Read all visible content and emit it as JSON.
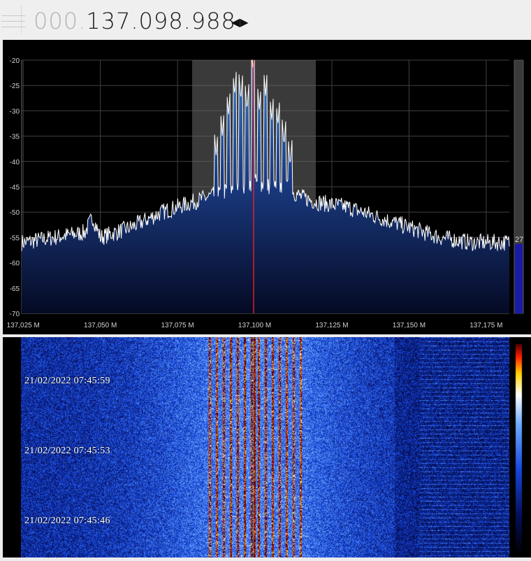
{
  "frequency": {
    "dim_part": "000.",
    "main_part": "137.098.988",
    "step_icon": "left-right-arrows"
  },
  "spectrum": {
    "y_ticks": [
      "-20",
      "-25",
      "-30",
      "-35",
      "-40",
      "-45",
      "-50",
      "-55",
      "-60",
      "-65",
      "-70"
    ],
    "x_ticks": [
      "137,025 M",
      "137,050 M",
      "137,075 M",
      "137,100 M",
      "137,125 M",
      "137,150 M",
      "137,175 M"
    ],
    "signal_meter_value": "27",
    "colors": {
      "background": "#000000",
      "grid": "#404040",
      "trace": "#ffffff",
      "fill_top": "#3f7fc6",
      "fill_bottom": "#050a24",
      "bandwidth_overlay": "#6a6a6a",
      "tuned_marker": "#ff2020"
    }
  },
  "chart_data": {
    "type": "area",
    "title": "",
    "xlabel": "",
    "ylabel": "",
    "xlim": [
      137.0245,
      137.1825
    ],
    "ylim": [
      -70,
      -20
    ],
    "x_unit": "MHz",
    "tuned_frequency": 137.098988,
    "filter_band": [
      137.0795,
      137.1185
    ],
    "series": [
      {
        "values_by_mhz": [
          [
            137.025,
            -56
          ],
          [
            137.035,
            -55
          ],
          [
            137.045,
            -54
          ],
          [
            137.0475,
            -51
          ],
          [
            137.05,
            -55
          ],
          [
            137.06,
            -53
          ],
          [
            137.07,
            -50
          ],
          [
            137.08,
            -48
          ],
          [
            137.085,
            -47
          ],
          [
            137.09,
            -46
          ],
          [
            137.095,
            -45
          ],
          [
            137.1,
            -44
          ],
          [
            137.105,
            -45
          ],
          [
            137.11,
            -45
          ],
          [
            137.115,
            -47
          ],
          [
            137.12,
            -48
          ],
          [
            137.13,
            -49
          ],
          [
            137.14,
            -51
          ],
          [
            137.15,
            -53
          ],
          [
            137.16,
            -55
          ],
          [
            137.17,
            -56
          ],
          [
            137.1825,
            -56
          ]
        ],
        "peaks_by_mhz": [
          [
            137.0875,
            -39
          ],
          [
            137.0895,
            -35
          ],
          [
            137.0915,
            -31
          ],
          [
            137.0935,
            -27
          ],
          [
            137.0955,
            -28
          ],
          [
            137.0975,
            -30
          ],
          [
            137.0995,
            -22
          ],
          [
            137.1015,
            -30
          ],
          [
            137.1035,
            -27
          ],
          [
            137.1055,
            -32
          ],
          [
            137.1075,
            -33
          ],
          [
            137.1095,
            -37
          ],
          [
            137.1115,
            -41
          ]
        ]
      }
    ]
  },
  "waterfall": {
    "timestamps": [
      "21/02/2022 07:45:59",
      "21/02/2022 07:45:53",
      "21/02/2022 07:45:46"
    ],
    "colormap": [
      "#000000",
      "#0a1a7a",
      "#2a6aff",
      "#ffffff",
      "#ffd400",
      "#ff2000",
      "#5a0000"
    ]
  }
}
